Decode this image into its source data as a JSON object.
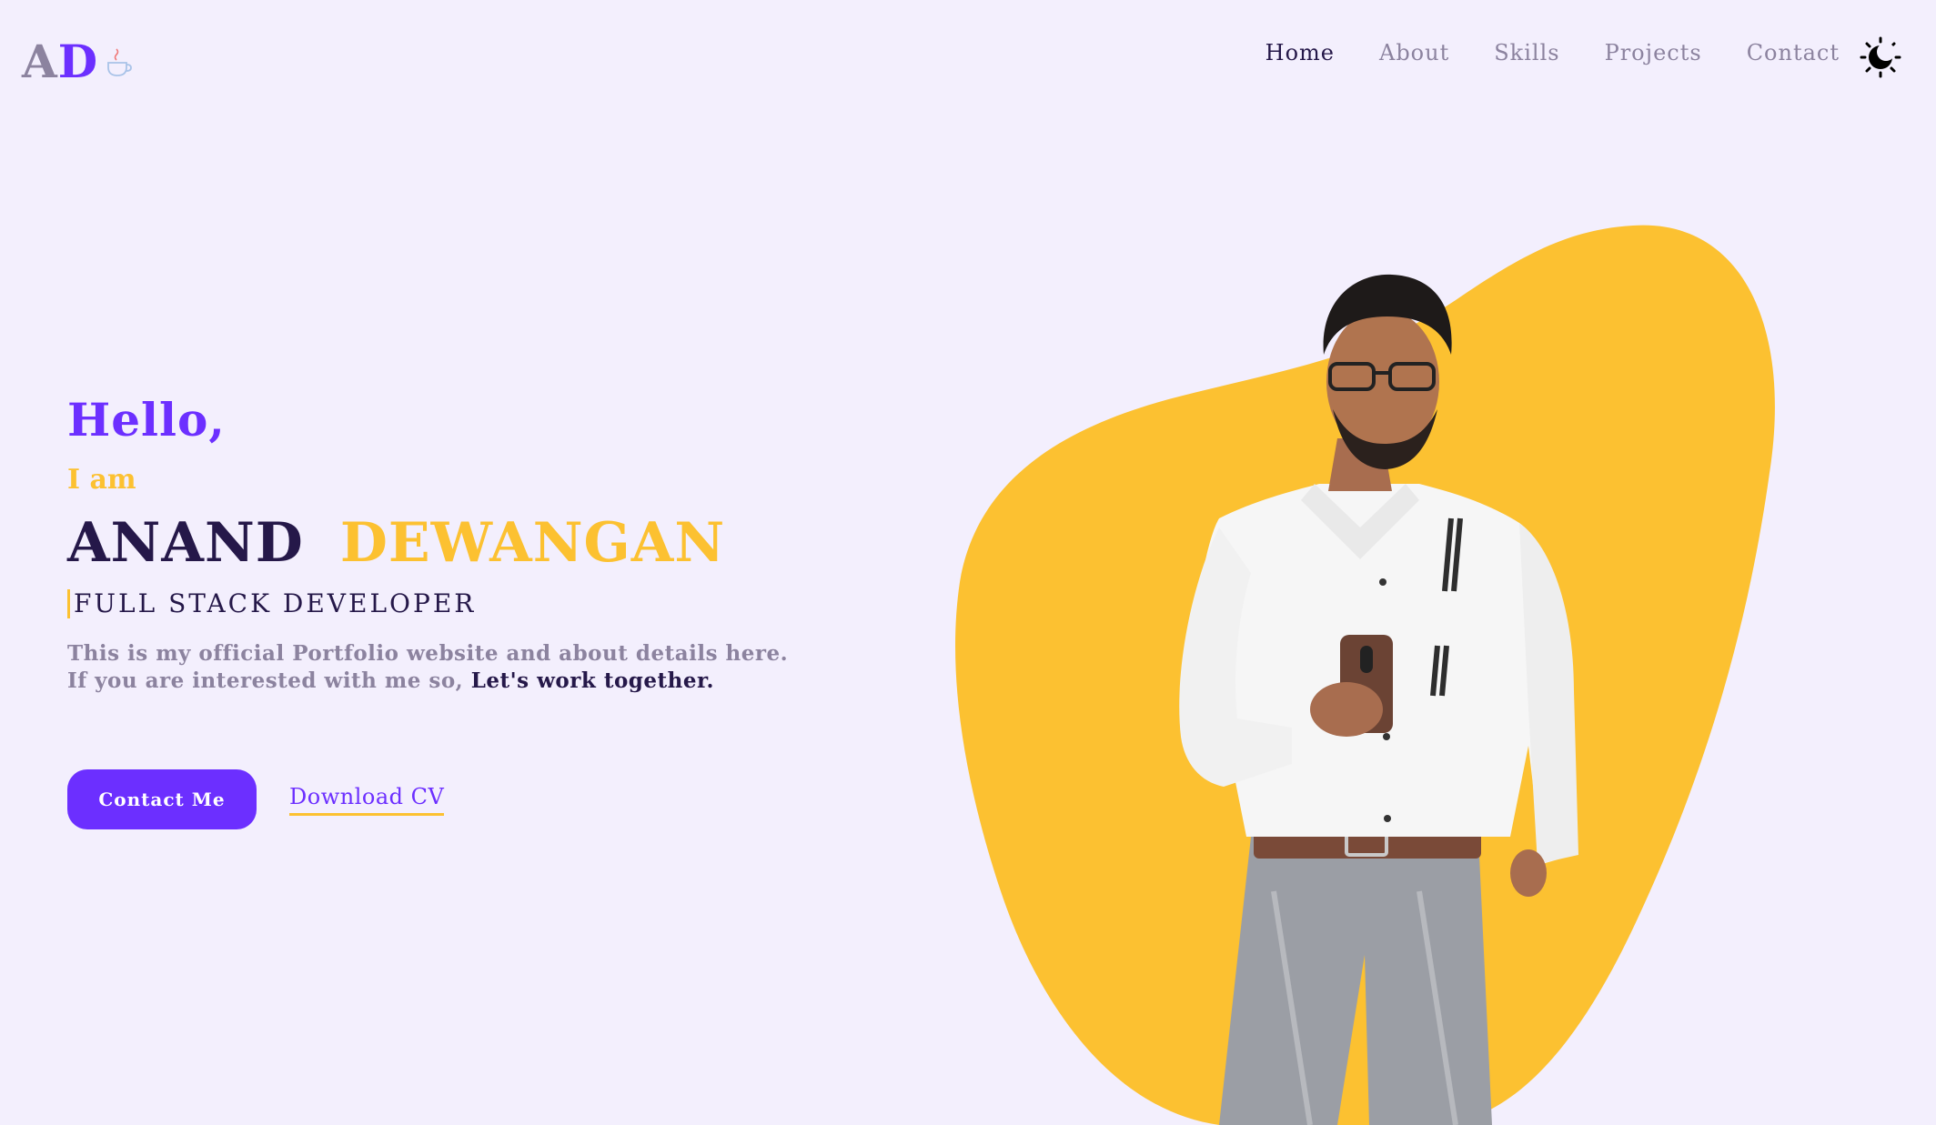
{
  "header": {
    "logo_a": "A",
    "logo_d": "D",
    "nav": [
      {
        "label": "Home",
        "active": true
      },
      {
        "label": "About",
        "active": false
      },
      {
        "label": "Skills",
        "active": false
      },
      {
        "label": "Projects",
        "active": false
      },
      {
        "label": "Contact",
        "active": false
      }
    ],
    "theme_icon": "moon-sun-icon"
  },
  "hero": {
    "greeting": "Hello,",
    "intro": "I am",
    "first_name": "ANAND",
    "last_name": "DEWANGAN",
    "role": "FULL STACK DEVELOPER",
    "desc_line1": "This is my official Portfolio website and about details here.",
    "desc_line2": "If you are interested with me so, ",
    "desc_cta": "Let's work together.",
    "contact_button": "Contact Me",
    "cv_link": "Download CV"
  },
  "colors": {
    "background": "#f3effd",
    "primary": "#6c2fff",
    "accent": "#fcc131",
    "dark": "#251849",
    "muted": "#8c839f"
  }
}
